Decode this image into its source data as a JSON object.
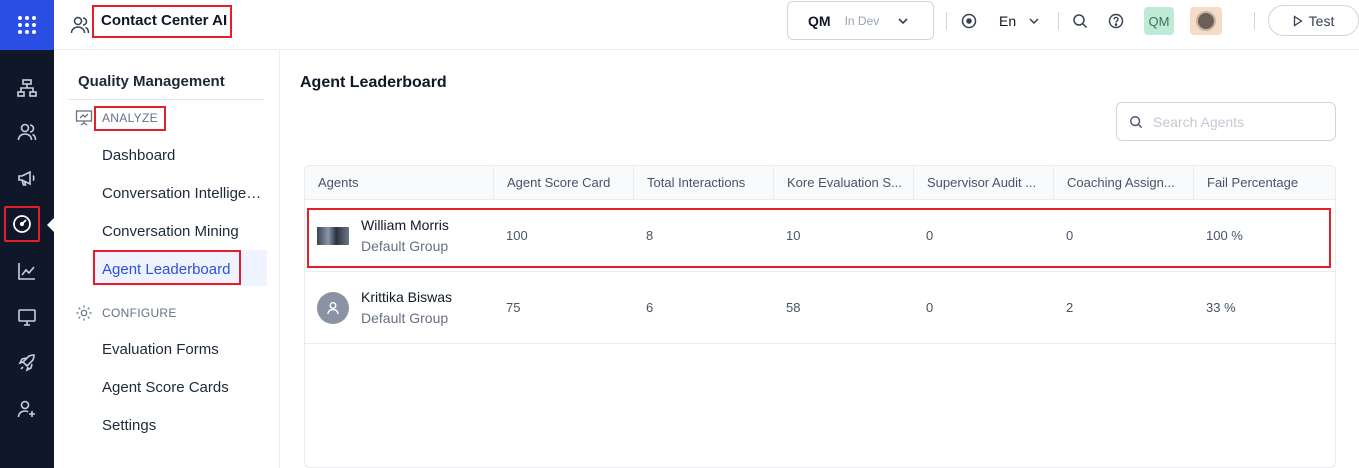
{
  "header": {
    "app_title": "Contact Center AI",
    "env_code": "QM",
    "env_status": "In Dev",
    "language": "En",
    "user_badge": "QM",
    "test_label": "Test"
  },
  "subnav": {
    "title": "Quality Management",
    "analyze_label": "ANALYZE",
    "analyze_items": [
      "Dashboard",
      "Conversation Intelligence",
      "Conversation Mining",
      "Agent Leaderboard"
    ],
    "configure_label": "CONFIGURE",
    "configure_items": [
      "Evaluation Forms",
      "Agent Score Cards",
      "Settings"
    ]
  },
  "main": {
    "title": "Agent Leaderboard",
    "search_placeholder": "Search Agents",
    "columns": [
      "Agents",
      "Agent Score Card",
      "Total Interactions",
      "Kore Evaluation S...",
      "Supervisor Audit ...",
      "Coaching Assign...",
      "Fail Percentage"
    ],
    "rows": [
      {
        "name": "William Morris",
        "group": "Default Group",
        "score_card": "100",
        "interactions": "8",
        "kore_eval": "10",
        "supervisor_audit": "0",
        "coaching": "0",
        "fail_pct": "100 %"
      },
      {
        "name": "Krittika Biswas",
        "group": "Default Group",
        "score_card": "75",
        "interactions": "6",
        "kore_eval": "58",
        "supervisor_audit": "0",
        "coaching": "2",
        "fail_pct": "33 %"
      }
    ]
  },
  "colors": {
    "rail_bg": "#0f1729",
    "rail_top": "#2a4ee3",
    "highlight": "#e3202a",
    "active_link": "#2a52d9"
  }
}
